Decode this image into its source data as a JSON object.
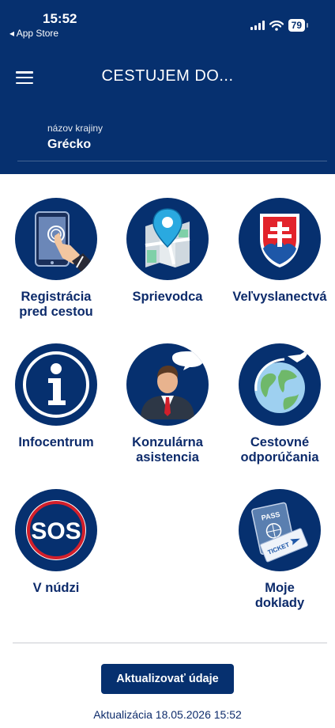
{
  "status_bar": {
    "time": "15:52",
    "back_label": "App Store",
    "battery": "79"
  },
  "header": {
    "title": "CESTUJEM DO...",
    "country_label": "názov krajiny",
    "country_value": "Grécko"
  },
  "tiles": [
    {
      "label_line1": "Registrácia",
      "label_line2": "pred cestou",
      "icon": "registration-tablet-icon"
    },
    {
      "label_line1": "Sprievodca",
      "label_line2": "",
      "icon": "map-pin-icon"
    },
    {
      "label_line1": "Veľvyslanectvá",
      "label_line2": "",
      "icon": "slovak-coat-of-arms-icon"
    },
    {
      "label_line1": "Infocentrum",
      "label_line2": "",
      "icon": "info-icon"
    },
    {
      "label_line1": "Konzulárna",
      "label_line2": "asistencia",
      "icon": "consul-person-icon"
    },
    {
      "label_line1": "Cestovné",
      "label_line2": "odporúčania",
      "icon": "globe-plane-icon"
    },
    {
      "label_line1": "V núdzi",
      "label_line2": "",
      "icon": "sos-icon",
      "sos_text": "SOS"
    },
    {
      "label_line1": "Moje",
      "label_line2": "doklady",
      "icon": "passport-ticket-icon",
      "pass_text": "PASS",
      "ticket_text": "TICKET"
    }
  ],
  "footer": {
    "update_button": "Aktualizovať údaje",
    "last_update": "Aktualizácia 18.05.2026 15:52"
  },
  "colors": {
    "primary": "#06306f",
    "text": "#0d2b6b",
    "sos_red": "#d21f2b",
    "slovak_red": "#e2232b",
    "slovak_blue": "#1d57a8"
  }
}
